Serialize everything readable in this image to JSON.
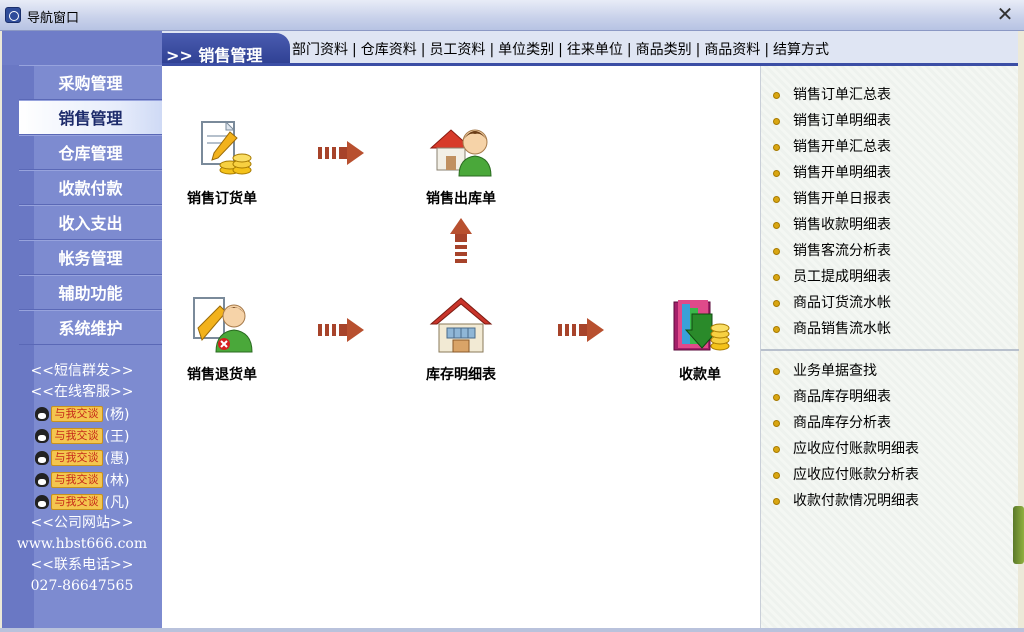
{
  "window": {
    "title": "导航窗口",
    "close_glyph": "✕"
  },
  "sidebar": {
    "items": [
      {
        "label": "采购管理",
        "active": false
      },
      {
        "label": "销售管理",
        "active": true
      },
      {
        "label": "仓库管理",
        "active": false
      },
      {
        "label": "收款付款",
        "active": false
      },
      {
        "label": "收入支出",
        "active": false
      },
      {
        "label": "帐务管理",
        "active": false
      },
      {
        "label": "辅助功能",
        "active": false
      },
      {
        "label": "系统维护",
        "active": false
      }
    ],
    "sms_link": "<<短信群发>>",
    "support_link": "<<在线客服>>",
    "chat_button_label": "与我交谈",
    "chat_contacts": [
      "(杨)",
      "(王)",
      "(惠)",
      "(林)",
      "(凡)"
    ],
    "website_link": "<<公司网站>>",
    "website_url": "www.hbst666.com",
    "phone_link": "<<联系电话>>",
    "phone_number": "027-86647565"
  },
  "topnav": {
    "current": ">> 销售管理",
    "links": [
      "部门资料",
      "仓库资料",
      "员工资料",
      "单位类别",
      "往来单位",
      "商品类别",
      "商品资料",
      "结算方式"
    ],
    "separator": "|"
  },
  "flow": {
    "sales_order": "销售订货单",
    "sales_outbound": "销售出库单",
    "sales_return": "销售退货单",
    "inventory_detail": "库存明细表",
    "receipt": "收款单"
  },
  "reports": {
    "group1": [
      "销售订单汇总表",
      "销售订单明细表",
      "销售开单汇总表",
      "销售开单明细表",
      "销售开单日报表",
      "销售收款明细表",
      "销售客流分析表",
      "员工提成明细表",
      "商品订货流水帐",
      "商品销售流水帐"
    ],
    "group2": [
      "业务单据查找",
      "商品库存明细表",
      "商品库存分析表",
      "应收应付账款明细表",
      "应收应付账款分析表",
      "收款付款情况明细表"
    ]
  },
  "colors": {
    "sidebar": "#7d8bd0",
    "tab": "#2e3f92",
    "arrow": "#a7432a",
    "bullet": "#d9a612"
  }
}
